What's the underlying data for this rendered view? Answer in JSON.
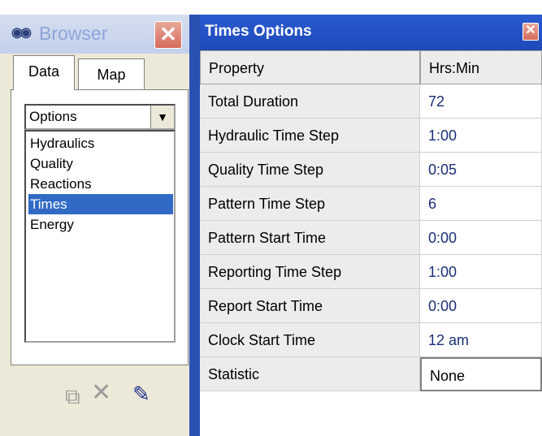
{
  "browser": {
    "title": "Browser",
    "tabs": [
      {
        "label": "Data"
      },
      {
        "label": "Map"
      }
    ],
    "dropdown": {
      "selected": "Options"
    },
    "items": [
      {
        "label": "Hydraulics"
      },
      {
        "label": "Quality"
      },
      {
        "label": "Reactions"
      },
      {
        "label": "Times"
      },
      {
        "label": "Energy"
      }
    ],
    "selected_item": "Times",
    "bottom_icons": [
      "copy-icon",
      "delete-icon",
      "edit-icon"
    ]
  },
  "times_options": {
    "title": "Times Options",
    "columns": [
      "Property",
      "Hrs:Min"
    ],
    "rows": [
      {
        "property": "Total Duration",
        "value": "72"
      },
      {
        "property": "Hydraulic Time Step",
        "value": "1:00"
      },
      {
        "property": "Quality Time Step",
        "value": "0:05"
      },
      {
        "property": "Pattern Time Step",
        "value": "6"
      },
      {
        "property": "Pattern Start Time",
        "value": "0:00"
      },
      {
        "property": "Reporting Time Step",
        "value": "1:00"
      },
      {
        "property": "Report Start Time",
        "value": "0:00"
      },
      {
        "property": "Clock Start Time",
        "value": "12 am"
      },
      {
        "property": "Statistic",
        "value": "None"
      }
    ]
  },
  "colors": {
    "title_bar_blue": "#2a5ad0",
    "selection_blue": "#316ac5",
    "value_text": "#1a2f78",
    "close_red": "#d66b5b"
  }
}
